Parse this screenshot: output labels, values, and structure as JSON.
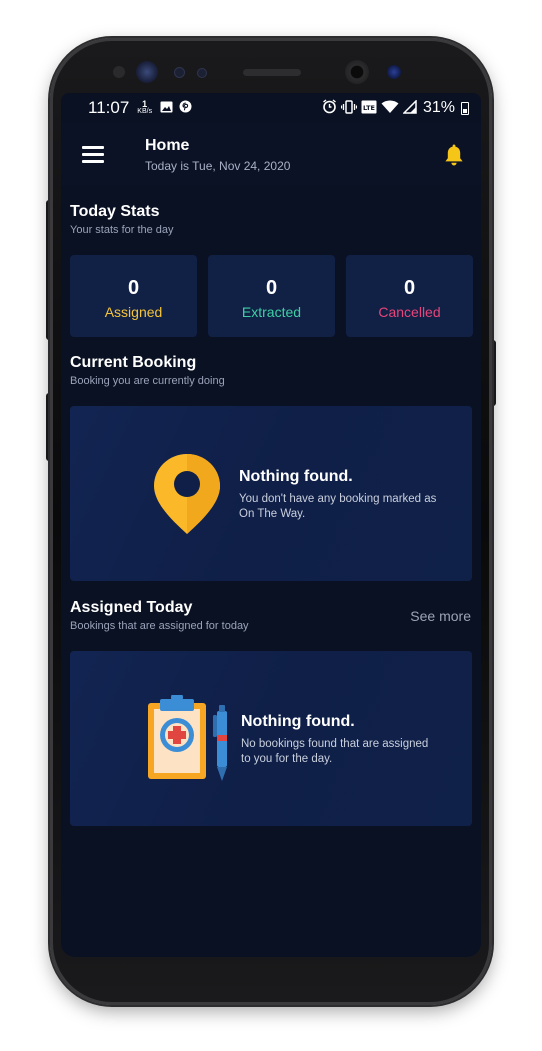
{
  "status_bar": {
    "time": "11:07",
    "speed_value": "1",
    "speed_unit": "KB/s",
    "network_label": "LTE",
    "battery": "31%"
  },
  "header": {
    "title": "Home",
    "subtitle": "Today is Tue, Nov 24, 2020"
  },
  "today_stats": {
    "title": "Today Stats",
    "subtitle": "Your stats for the day",
    "cards": [
      {
        "value": "0",
        "label": "Assigned",
        "color": "#f5c43a"
      },
      {
        "value": "0",
        "label": "Extracted",
        "color": "#3fcfa6"
      },
      {
        "value": "0",
        "label": "Cancelled",
        "color": "#e8457a"
      }
    ]
  },
  "current_booking": {
    "title": "Current Booking",
    "subtitle": "Booking you are currently doing",
    "empty_title": "Nothing found.",
    "empty_text": "You don't have any booking marked as On The Way."
  },
  "assigned_today": {
    "title": "Assigned Today",
    "subtitle": "Bookings that are assigned for today",
    "see_more": "See more",
    "empty_title": "Nothing found.",
    "empty_text": "No bookings found that are assigned to you for the day."
  },
  "icons": {
    "menu": "hamburger-icon",
    "notification": "bell-icon",
    "location": "map-pin-icon",
    "clipboard": "medical-clipboard-icon",
    "pen": "pen-icon"
  }
}
